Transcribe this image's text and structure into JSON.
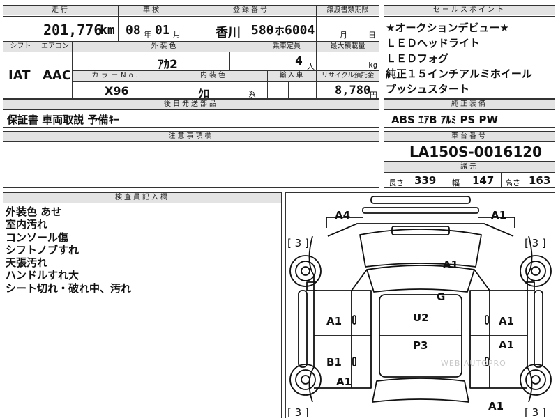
{
  "top_labels": {
    "mileage": "走行",
    "inspection": "車検",
    "registration": "登録番号",
    "transfer_deadline": "譲渡書類期限",
    "sales_points": "セールスポイント"
  },
  "mileage": {
    "value": "201,776",
    "unit": "km"
  },
  "inspection": {
    "year": "08",
    "year_unit": "年",
    "month": "01",
    "month_unit": "月"
  },
  "registration": {
    "region": "香川",
    "class": "580",
    "kana": "ホ",
    "number": "6004"
  },
  "transfer": {
    "month_unit": "月",
    "day_unit": "日"
  },
  "row2_labels": {
    "shift": "シフト",
    "aircon": "エアコン",
    "exterior_color": "外装色",
    "capacity": "乗車定員",
    "max_load": "最大積載量"
  },
  "shift": "IAT",
  "aircon": "AAC",
  "exterior_color": "ｱｶ2",
  "capacity": {
    "value": "4",
    "unit": "人"
  },
  "max_load": {
    "unit": "kg"
  },
  "row3_labels": {
    "color_no": "カラーNo.",
    "interior_color": "内装色",
    "import": "輸入車",
    "recycle": "リサイクル預託金"
  },
  "color_no": "X96",
  "interior_color": {
    "value": "ｸﾛ",
    "suffix": "系"
  },
  "recycle": {
    "value": "8,780",
    "unit": "円"
  },
  "accessories": {
    "label": "後日発送部品",
    "value": "保証書 車両取説 予備ｷｰ"
  },
  "notes": {
    "label": "注意事項欄"
  },
  "sales_points": [
    "★オークションデビュー★",
    "ＬＥＤヘッドライト",
    "ＬＥＤフォグ",
    "純正１５インチアルミホイール",
    "プッシュスタート"
  ],
  "genuine_equipment": {
    "label": "純正装備",
    "value": "ABS ｴｱB ｱﾙﾐ PS PW"
  },
  "chassis": {
    "label": "車台番号",
    "value": "LA150S-0016120"
  },
  "specs": {
    "label": "諸元",
    "length_label": "長さ",
    "length": "339",
    "width_label": "幅",
    "width": "147",
    "height_label": "高さ",
    "height": "163"
  },
  "inspector": {
    "label": "検査員記入欄",
    "lines": [
      "外装色 あせ",
      "室内汚れ",
      "コンソール傷",
      "シフトノブすれ",
      "天張汚れ",
      "ハンドルすれ大",
      "シート切れ・破れ中、汚れ"
    ]
  },
  "diagram": {
    "marks": {
      "front_left": "A4",
      "front_right": "A1",
      "hood": "A1",
      "roof_front": "G",
      "roof_mid": "U2",
      "roof_rear": "P3",
      "left_front_door": "A1",
      "left_rear_door": "B1",
      "left_rear_quarter": "A1",
      "right_front_door": "A1",
      "right_rear_door": "A1",
      "rear_right": "A1"
    },
    "tire_labels": [
      "[ 3 ]",
      "[ 3 ]",
      "[ 3 ]",
      "[ 3 ]"
    ],
    "watermark": "WEB AUTOPRO"
  },
  "colors": {
    "header_bg": "#e3e3e3",
    "border": "#333333"
  }
}
